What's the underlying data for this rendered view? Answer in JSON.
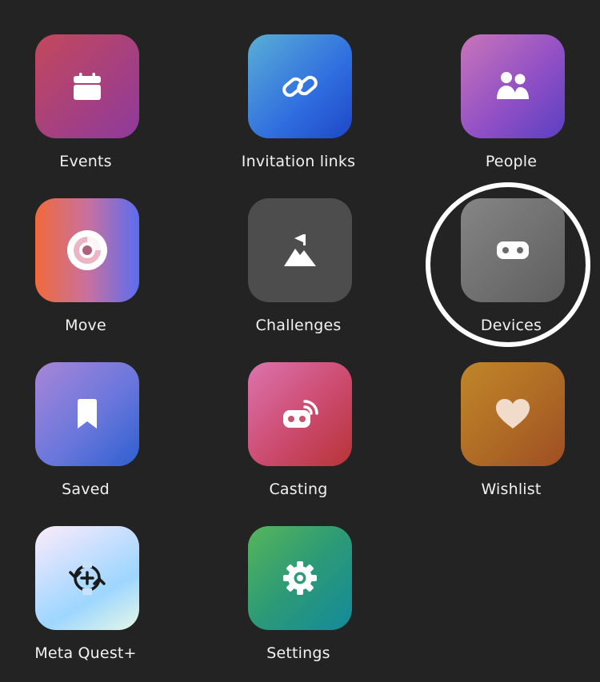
{
  "menu": {
    "items": [
      {
        "label": "Events",
        "icon": "calendar-icon"
      },
      {
        "label": "Invitation links",
        "icon": "link-icon"
      },
      {
        "label": "People",
        "icon": "people-icon"
      },
      {
        "label": "Move",
        "icon": "move-ring-icon"
      },
      {
        "label": "Challenges",
        "icon": "mountain-flag-icon"
      },
      {
        "label": "Devices",
        "icon": "headset-icon"
      },
      {
        "label": "Saved",
        "icon": "bookmark-icon"
      },
      {
        "label": "Casting",
        "icon": "cast-headset-icon"
      },
      {
        "label": "Wishlist",
        "icon": "heart-icon"
      },
      {
        "label": "Meta Quest+",
        "icon": "quest-plus-icon"
      },
      {
        "label": "Settings",
        "icon": "gear-icon"
      }
    ]
  },
  "highlight": {
    "target": "Devices",
    "color": "#ffffff"
  },
  "colors": {
    "background": "#232323",
    "label_text": "#f2f2f2"
  }
}
